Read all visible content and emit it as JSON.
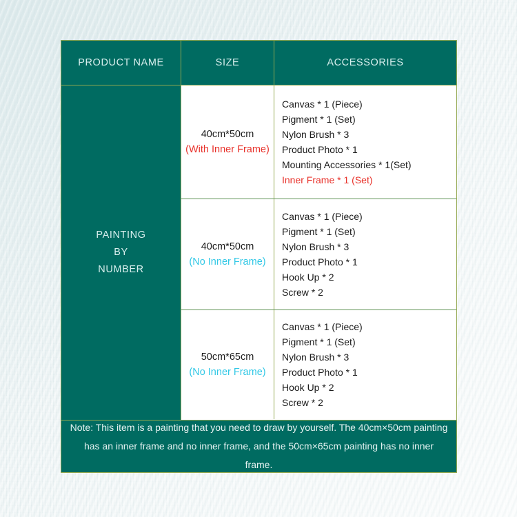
{
  "table": {
    "headers": {
      "product_name": "PRODUCT NAME",
      "size": "SIZE",
      "accessories": "ACCESSORIES"
    },
    "product_name": {
      "line1": "PAINTING",
      "line2": "BY",
      "line3": "NUMBER"
    },
    "rows": [
      {
        "size_dimension": "40cm*50cm",
        "size_note": "(With Inner Frame)",
        "size_note_color": "#e8312a",
        "accessories": [
          {
            "text": "Canvas * 1 (Piece)",
            "color": "#1b1b1b"
          },
          {
            "text": "Pigment * 1 (Set)",
            "color": "#1b1b1b"
          },
          {
            "text": "Nylon Brush * 3",
            "color": "#1b1b1b"
          },
          {
            "text": "Product Photo * 1",
            "color": "#1b1b1b"
          },
          {
            "text": "Mounting Accessories * 1(Set)",
            "color": "#1b1b1b"
          },
          {
            "text": "Inner Frame * 1 (Set)",
            "color": "#e8312a"
          }
        ]
      },
      {
        "size_dimension": "40cm*50cm",
        "size_note": "(No Inner Frame)",
        "size_note_color": "#32c8e6",
        "accessories": [
          {
            "text": "Canvas * 1 (Piece)",
            "color": "#1b1b1b"
          },
          {
            "text": "Pigment * 1 (Set)",
            "color": "#1b1b1b"
          },
          {
            "text": "Nylon Brush * 3",
            "color": "#1b1b1b"
          },
          {
            "text": "Product Photo * 1",
            "color": "#1b1b1b"
          },
          {
            "text": "Hook Up * 2",
            "color": "#1b1b1b"
          },
          {
            "text": "Screw * 2",
            "color": "#1b1b1b"
          }
        ]
      },
      {
        "size_dimension": "50cm*65cm",
        "size_note": "(No Inner Frame)",
        "size_note_color": "#32c8e6",
        "accessories": [
          {
            "text": "Canvas * 1 (Piece)",
            "color": "#1b1b1b"
          },
          {
            "text": "Pigment * 1 (Set)",
            "color": "#1b1b1b"
          },
          {
            "text": "Nylon Brush * 3",
            "color": "#1b1b1b"
          },
          {
            "text": "Product Photo * 1",
            "color": "#1b1b1b"
          },
          {
            "text": "Hook Up * 2",
            "color": "#1b1b1b"
          },
          {
            "text": "Screw * 2",
            "color": "#1b1b1b"
          }
        ]
      }
    ],
    "note": "Note: This item is a painting that you need to draw by yourself. The 40cm×50cm painting has an inner frame and no inner frame, and the 50cm×65cm painting has no inner frame."
  },
  "colors": {
    "teal": "#006b61",
    "olive_border": "#93a84f",
    "inner_border": "#5e9253",
    "header_text": "#d8efee",
    "red": "#e8312a",
    "cyan": "#32c8e6",
    "body_text": "#1b1b1b"
  }
}
